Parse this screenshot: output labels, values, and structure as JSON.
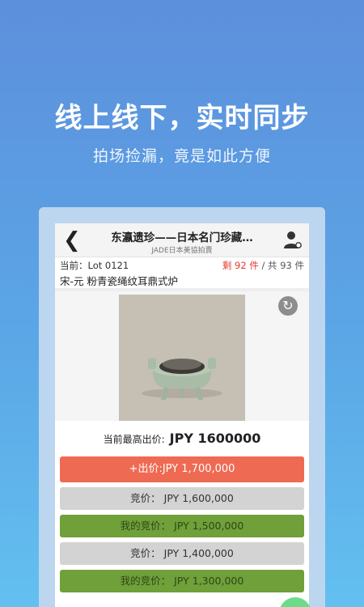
{
  "promo": {
    "headline": "线上线下，实时同步",
    "subline": "拍场捡漏，竟是如此方便"
  },
  "nav": {
    "back_icon": "back-arrow-icon",
    "title": "东瀛遗珍——日本名门珍藏…",
    "subtitle": "JADE日本美協拍賣",
    "user_icon": "user-settings-icon"
  },
  "lot": {
    "current_label": "当前：Lot 0121",
    "remaining": "剩 92 件",
    "total": " / 共 93 件",
    "title": "宋-元 粉青瓷绳纹耳鼎式炉"
  },
  "image": {
    "refresh_icon": "refresh-icon"
  },
  "highest_bid": {
    "label": "当前最高出价:",
    "value": "JPY 1600000"
  },
  "bid_button": {
    "label": "+出价:JPY 1,700,000",
    "color": "#ef6a52"
  },
  "history": [
    {
      "text": "竞价：  JPY 1,600,000",
      "mine": false
    },
    {
      "text": "我的竞价：  JPY 1,500,000",
      "mine": true
    },
    {
      "text": "竞价：  JPY 1,400,000",
      "mine": false
    },
    {
      "text": "我的竞价：  JPY 1,300,000",
      "mine": true
    }
  ],
  "colors": {
    "accent_red": "#e43c2e",
    "mine_green": "#6fa03a",
    "other_gray": "#d3d3d3"
  }
}
